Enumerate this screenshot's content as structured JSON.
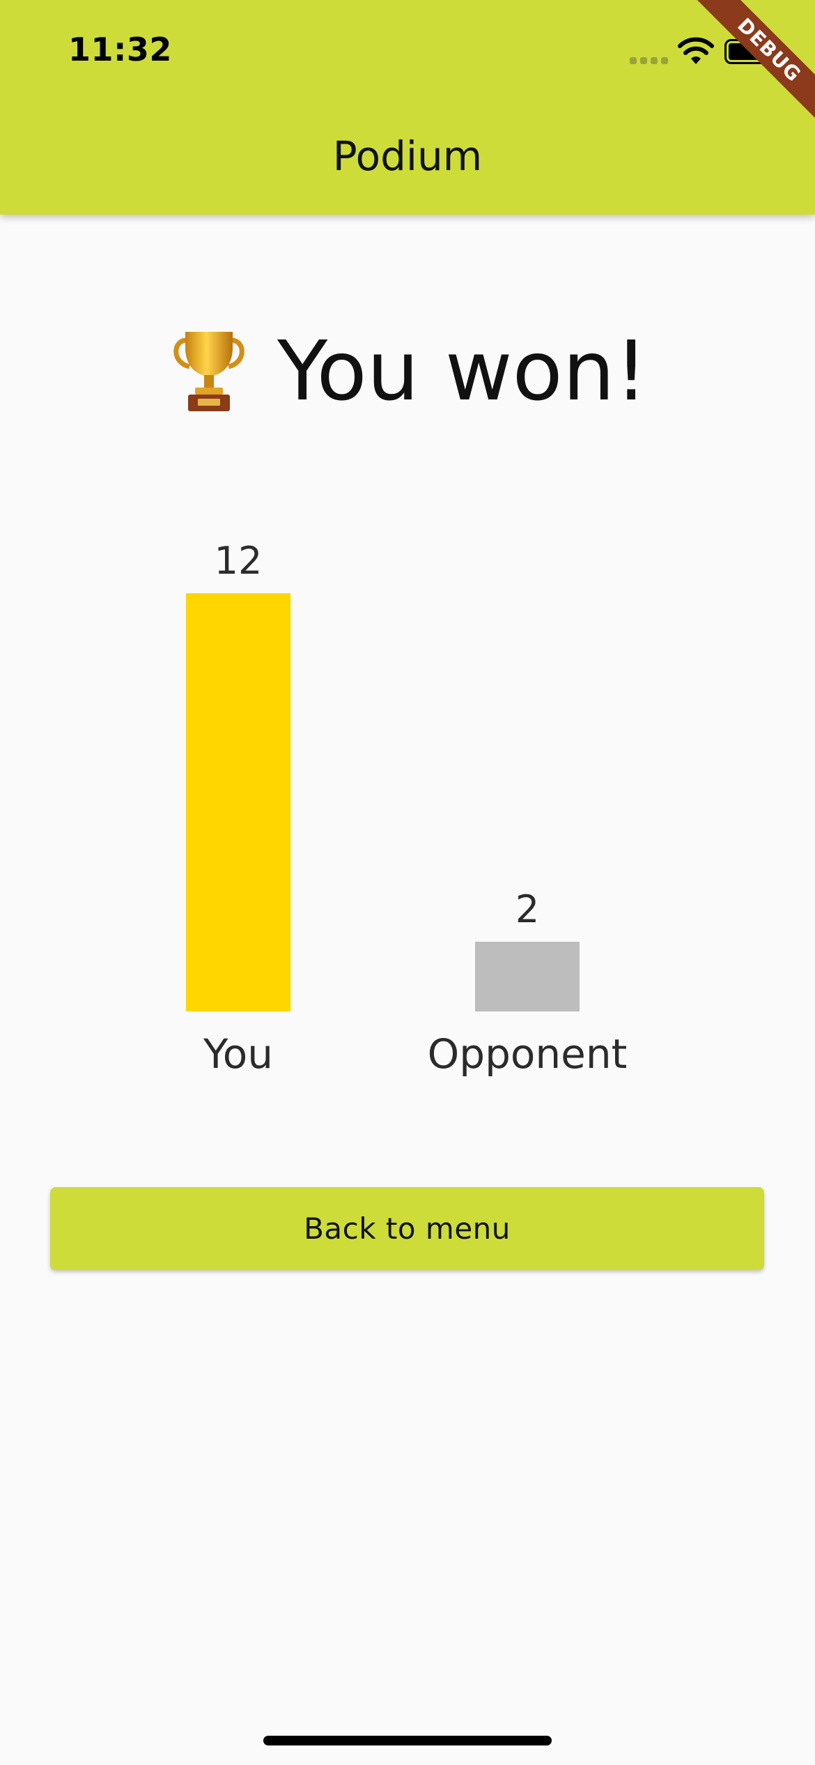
{
  "status_bar": {
    "time": "11:32",
    "icons": [
      "cellular-signal-icon",
      "wifi-icon",
      "battery-icon"
    ]
  },
  "debug_banner": "DEBUG",
  "app_bar": {
    "title": "Podium"
  },
  "result": {
    "icon": "trophy-icon",
    "text": "You won!"
  },
  "chart_data": {
    "type": "bar",
    "categories": [
      "You",
      "Opponent"
    ],
    "values": [
      12,
      2
    ],
    "colors": [
      "#ffd600",
      "#bdbdbd"
    ],
    "value_labels": [
      "12",
      "2"
    ]
  },
  "actions": {
    "back_label": "Back to menu"
  },
  "colors": {
    "accent": "#cddc39",
    "background": "#fafafa"
  }
}
